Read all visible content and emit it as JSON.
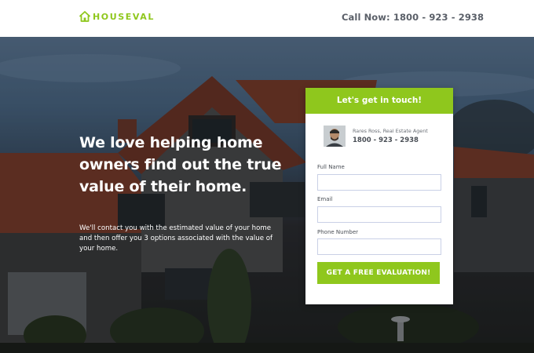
{
  "brand": {
    "logo_text": "HOUSEVAL",
    "logo_icon": "house-icon",
    "accent_color": "#8fc71d"
  },
  "header": {
    "call_text": "Call Now: 1800 - 923 - 2938"
  },
  "hero": {
    "headline": "We love helping home owners find out the true value of their home.",
    "subtext": "We'll contact you with the estimated value of your home and then offer you 3 options associated with the value of your home."
  },
  "form": {
    "title": "Let's get in touch!",
    "agent": {
      "name": "Rares Ross, Real Estate Agent",
      "phone": "1800 - 923 - 2938"
    },
    "fields": [
      {
        "label": "Full Name",
        "value": ""
      },
      {
        "label": "Email",
        "value": ""
      },
      {
        "label": "Phone Number",
        "value": ""
      }
    ],
    "submit_label": "GET A FREE EVALUATION!"
  }
}
